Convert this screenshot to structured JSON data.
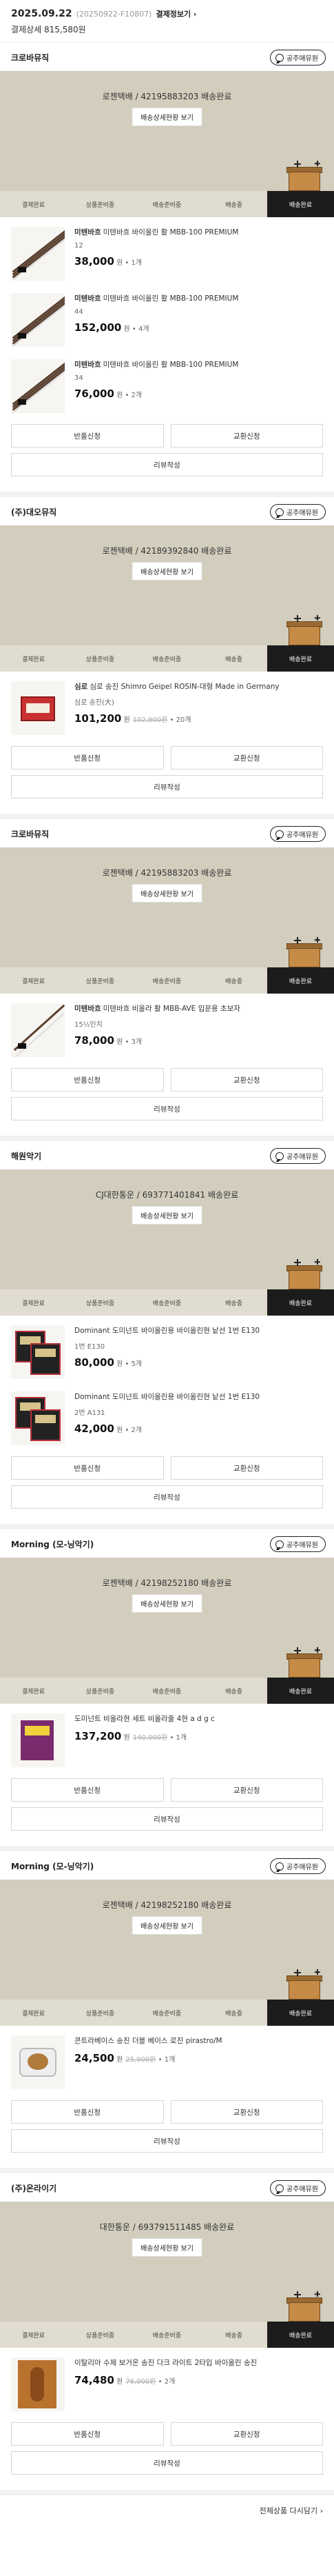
{
  "order": {
    "date": "2025.09.22",
    "order_no": "(20250922-F10807)",
    "receipt_link": "결제정보기",
    "total": "결제상세 815,580원"
  },
  "colors": {
    "panel": "#d2cdbd",
    "active_step": "#1c1c1c"
  },
  "common": {
    "chat_label": "공주애뮤원",
    "ship_detail_btn": "배송상세현황 보기",
    "steps": [
      "결제완료",
      "상품준비중",
      "배송준비중",
      "배송중",
      "배송완료"
    ],
    "return_btn": "반품신청",
    "exchange_btn": "교환신청",
    "review_btn": "리뷰작성",
    "won": "원",
    "footer_link": "전체상품 다시담기"
  },
  "sellers": [
    {
      "name": "크로바뮤직",
      "ship_title": "로젠택배 / 42195883203 배송완료",
      "products": [
        {
          "brand": "미텐바흐",
          "name": "미텐바흐 바이올린 활 MBB-100 PREMIUM",
          "option": "12",
          "price": "38,000",
          "qty": "1개",
          "orig": "",
          "thumb": "bow"
        },
        {
          "brand": "미텐바흐",
          "name": "미텐바흐 바이올린 활 MBB-100 PREMIUM",
          "option": "44",
          "price": "152,000",
          "qty": "4개",
          "orig": "",
          "thumb": "bow"
        },
        {
          "brand": "미텐바흐",
          "name": "미텐바흐 바이올린 활 MBB-100 PREMIUM",
          "option": "34",
          "price": "76,000",
          "qty": "2개",
          "orig": "",
          "thumb": "bow"
        }
      ]
    },
    {
      "name": "(주)대오뮤직",
      "ship_title": "로젠택배 / 42189392840 배송완료",
      "products": [
        {
          "brand": "심로",
          "name": "심로 송진 Shimro Geipel ROSIN-대형 Made in Germany",
          "option": "심로 송진(大)",
          "price": "101,200",
          "qty": "20개",
          "orig": "102,900원",
          "thumb": "rosin"
        }
      ]
    },
    {
      "name": "크로바뮤직",
      "ship_title": "로젠택배 / 42195883203 배송완료",
      "products": [
        {
          "brand": "미텐바흐",
          "name": "미텐바흐 비올라 활 MBB-AVE 입문용 초보자",
          "option": "15½인치",
          "price": "78,000",
          "qty": "3개",
          "orig": "",
          "thumb": "bow2"
        }
      ]
    },
    {
      "name": "해원악기",
      "ship_title": "CJ대한통운 / 693771401841 배송완료",
      "products": [
        {
          "brand": "",
          "name": "Dominant 도미넌트 바이올린용 바이올린현 낱선 1번 E130",
          "option": "1번 E130",
          "price": "80,000",
          "qty": "5개",
          "orig": "",
          "thumb": "strings"
        },
        {
          "brand": "",
          "name": "Dominant 도미넌트 바이올린용 바이올린현 낱선 1번 E130",
          "option": "2번 A131",
          "price": "42,000",
          "qty": "2개",
          "orig": "",
          "thumb": "strings"
        }
      ]
    },
    {
      "name": "Morning (모-닝악기)",
      "ship_title": "로젠택배 / 42198252180 배송완료",
      "products": [
        {
          "brand": "",
          "name": "도미넌트 비올라현 세트 비올라줄 4현 a d g c",
          "option": "",
          "price": "137,200",
          "qty": "1개",
          "orig": "140,000원",
          "thumb": "book"
        }
      ]
    },
    {
      "name": "Morning (모-닝악기)",
      "ship_title": "로젠택배 / 42198252180 배송완료",
      "products": [
        {
          "brand": "",
          "name": "콘트라베이스 송진 더블 베이스 로진 pirastro/M",
          "option": "",
          "price": "24,500",
          "qty": "1개",
          "orig": "25,000원",
          "thumb": "pot"
        }
      ]
    },
    {
      "name": "(주)온라이기",
      "ship_title": "대한통운 / 693791511485 배송완료",
      "products": [
        {
          "brand": "",
          "name": "이탈리아 수제 보거온 송진 다크 라이트 2타입 바이올린 송진",
          "option": "",
          "price": "74,480",
          "qty": "2개",
          "orig": "76,000원",
          "thumb": "vbook"
        }
      ]
    }
  ]
}
